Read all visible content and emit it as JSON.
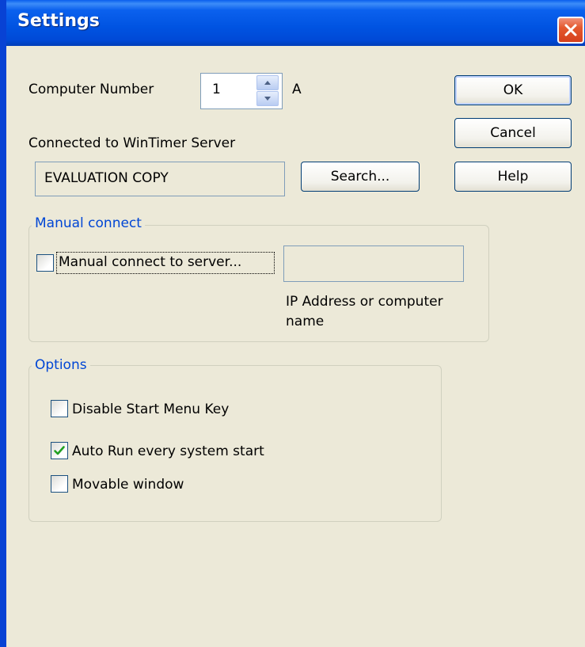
{
  "window": {
    "title": "Settings"
  },
  "computer_number": {
    "label": "Computer Number",
    "value": "1",
    "suffix": "A"
  },
  "server": {
    "label": "Connected to WinTimer Server",
    "value": "EVALUATION COPY",
    "search_label": "Search..."
  },
  "buttons": {
    "ok": "OK",
    "cancel": "Cancel",
    "help": "Help"
  },
  "manual_connect": {
    "group_title": "Manual connect",
    "checkbox_label": "Manual connect to server...",
    "checked": false,
    "input_value": "",
    "input_caption_line1": "IP Address or computer",
    "input_caption_line2": "name"
  },
  "options": {
    "group_title": "Options",
    "items": [
      {
        "label": "Disable Start Menu Key",
        "checked": false
      },
      {
        "label": "Auto Run every system start",
        "checked": true
      },
      {
        "label": "Movable window",
        "checked": false
      }
    ]
  },
  "colors": {
    "titlebar": "#0054E3",
    "face": "#ECE9D8",
    "group_title": "#0046D5",
    "check": "#21A121",
    "close": "#E4592F"
  }
}
